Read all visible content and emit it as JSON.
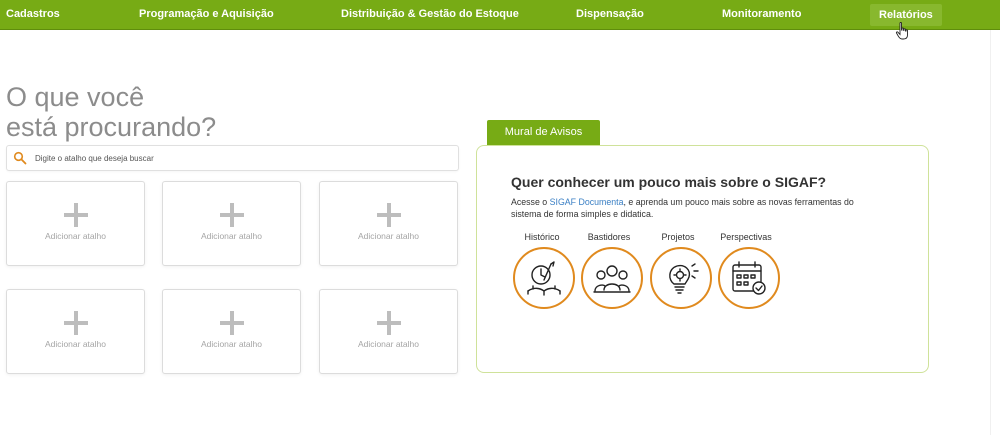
{
  "nav": {
    "items": [
      {
        "label": "Cadastros"
      },
      {
        "label": "Programação e Aquisição"
      },
      {
        "label": "Distribuição & Gestão do Estoque"
      },
      {
        "label": "Dispensação"
      },
      {
        "label": "Monitoramento"
      },
      {
        "label": "Relatórios",
        "active": true
      }
    ]
  },
  "heading": {
    "line1": "O que você",
    "line2": "está procurando?"
  },
  "search": {
    "placeholder": "Digite o atalho que deseja buscar",
    "icon": "search-icon"
  },
  "shortcuts": {
    "tiles": [
      {
        "label": "Adicionar atalho"
      },
      {
        "label": "Adicionar atalho"
      },
      {
        "label": "Adicionar atalho"
      },
      {
        "label": "Adicionar atalho"
      },
      {
        "label": "Adicionar atalho"
      },
      {
        "label": "Adicionar atalho"
      }
    ]
  },
  "mural": {
    "tab_label": "Mural de Avisos",
    "title": "Quer conhecer um pouco mais sobre o SIGAF?",
    "desc_prefix": "Acesse o ",
    "desc_link": "SIGAF Documenta",
    "desc_suffix": ", e aprenda um pouco mais sobre as novas ferramentas do sistema de forma simples e didatica.",
    "topics": [
      {
        "label": "Histórico",
        "icon": "history-book-icon"
      },
      {
        "label": "Bastidores",
        "icon": "team-icon"
      },
      {
        "label": "Projetos",
        "icon": "lightbulb-gear-icon"
      },
      {
        "label": "Perspectivas",
        "icon": "calendar-check-icon"
      }
    ]
  },
  "colors": {
    "brand_green": "#77ab15",
    "accent_orange": "#e08a1e",
    "link_blue": "#3a7fc4"
  }
}
